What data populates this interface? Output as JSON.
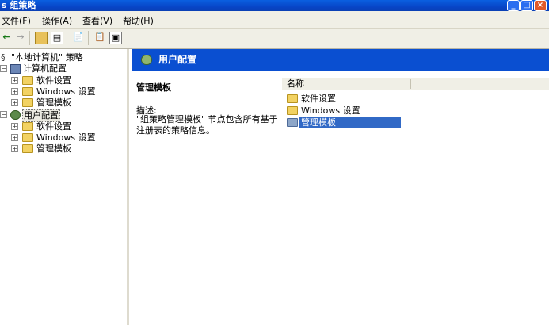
{
  "window": {
    "title": "s 组策略"
  },
  "menu": [
    "文件(F)",
    "操作(A)",
    "查看(V)",
    "帮助(H)"
  ],
  "tree": {
    "root": "\"本地计算机\" 策略",
    "computer": {
      "label": "计算机配置",
      "children": [
        "软件设置",
        "Windows 设置",
        "管理模板"
      ]
    },
    "user": {
      "label": "用户配置",
      "children": [
        "软件设置",
        "Windows 设置",
        "管理模板"
      ]
    }
  },
  "header": {
    "title": "用户配置"
  },
  "description": {
    "title": "管理模板",
    "label": "描述:",
    "text": "\"组策略管理模板\" 节点包含所有基于注册表的策略信息。"
  },
  "list": {
    "column_name": "名称",
    "items": [
      "软件设置",
      "Windows 设置",
      "管理模板"
    ],
    "selected_index": 2
  },
  "colors": {
    "header_blue": "#0a4fd1",
    "selection": "#3169c6"
  }
}
